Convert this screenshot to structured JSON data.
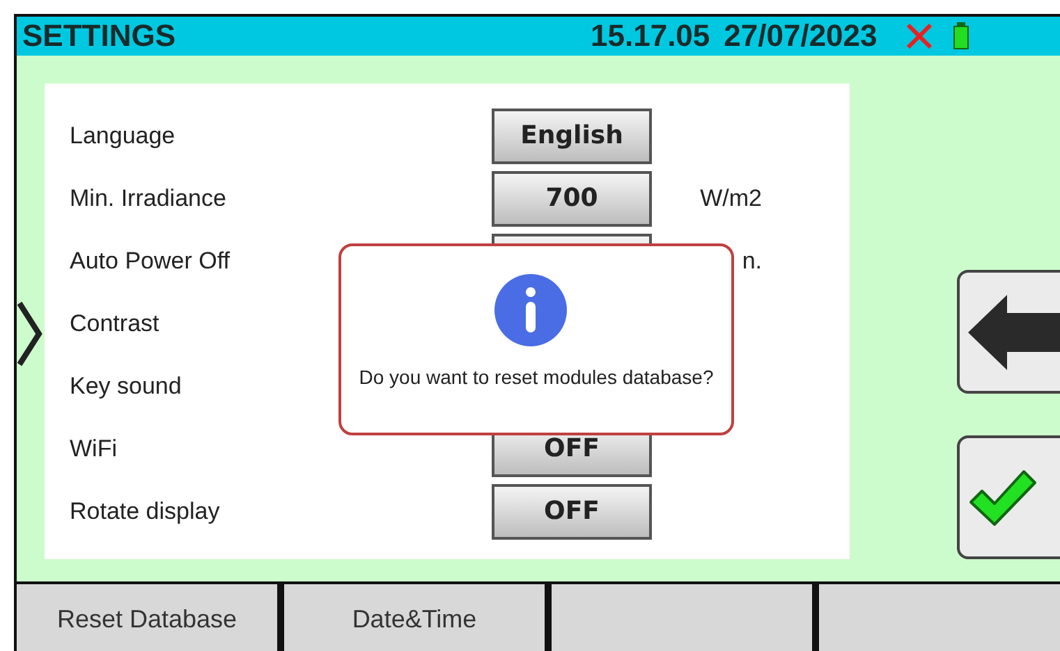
{
  "header": {
    "title": "SETTINGS",
    "time": "15.17.05",
    "date": "27/07/2023"
  },
  "settings": [
    {
      "label": "Language",
      "value": "English"
    },
    {
      "label": "Min. Irradiance",
      "value": "700",
      "unit": "W/m2"
    },
    {
      "label": "Auto Power Off",
      "unit": "n."
    },
    {
      "label": "Contrast"
    },
    {
      "label": "Key sound"
    },
    {
      "label": "WiFi",
      "value": "OFF"
    },
    {
      "label": "Rotate display",
      "value": "OFF"
    }
  ],
  "dialog": {
    "message": "Do you want to reset modules database?"
  },
  "softkeys": [
    {
      "label": "Reset Database"
    },
    {
      "label": "Date&Time"
    }
  ]
}
